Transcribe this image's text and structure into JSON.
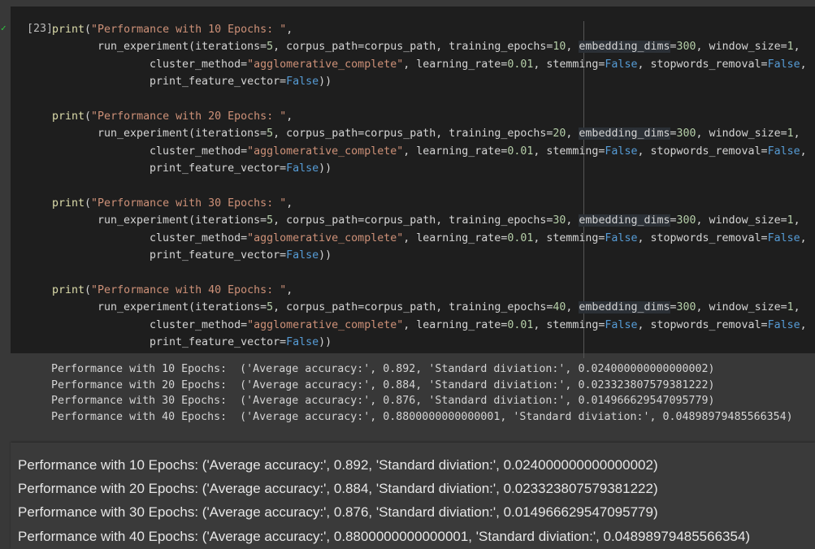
{
  "cell": {
    "execution_count": "[23]",
    "status_icon": "check-icon",
    "code_lines": [
      {
        "indent": 0,
        "tokens": [
          [
            "fn",
            "print"
          ],
          [
            "",
            "("
          ],
          [
            "str",
            "\"Performance with 10 Epochs: \""
          ],
          [
            "",
            ","
          ]
        ]
      },
      {
        "indent": 1,
        "tokens": [
          [
            "",
            "run_experiment(iterations="
          ],
          [
            "num",
            "5"
          ],
          [
            "",
            ", corpus_path=corpus_path, training_epochs="
          ],
          [
            "num",
            "10"
          ],
          [
            "",
            ", "
          ],
          [
            "hl",
            "embedding_dims"
          ],
          [
            "",
            "="
          ],
          [
            "num",
            "300"
          ],
          [
            "",
            ", window_size="
          ],
          [
            "num",
            "1"
          ],
          [
            "",
            ","
          ]
        ]
      },
      {
        "indent": 2,
        "tokens": [
          [
            "",
            "cluster_method="
          ],
          [
            "str",
            "\"agglomerative_complete\""
          ],
          [
            "",
            ", learning_rate="
          ],
          [
            "num",
            "0.01"
          ],
          [
            "",
            ", stemming="
          ],
          [
            "kw",
            "False"
          ],
          [
            "",
            ", stopwords_removal="
          ],
          [
            "kw",
            "False"
          ],
          [
            "",
            ","
          ]
        ]
      },
      {
        "indent": 2,
        "tokens": [
          [
            "",
            "print_feature_vector="
          ],
          [
            "kw",
            "False"
          ],
          [
            "",
            "))"
          ]
        ]
      },
      {
        "indent": 0,
        "tokens": [
          [
            "fn",
            "print"
          ],
          [
            "",
            "("
          ],
          [
            "str",
            "\"Performance with 20 Epochs: \""
          ],
          [
            "",
            ","
          ]
        ]
      },
      {
        "indent": 1,
        "tokens": [
          [
            "",
            "run_experiment(iterations="
          ],
          [
            "num",
            "5"
          ],
          [
            "",
            ", corpus_path=corpus_path, training_epochs="
          ],
          [
            "num",
            "20"
          ],
          [
            "",
            ", "
          ],
          [
            "hl",
            "embedding_dims"
          ],
          [
            "",
            "="
          ],
          [
            "num",
            "300"
          ],
          [
            "",
            ", window_size="
          ],
          [
            "num",
            "1"
          ],
          [
            "",
            ","
          ]
        ]
      },
      {
        "indent": 2,
        "tokens": [
          [
            "",
            "cluster_method="
          ],
          [
            "str",
            "\"agglomerative_complete\""
          ],
          [
            "",
            ", learning_rate="
          ],
          [
            "num",
            "0.01"
          ],
          [
            "",
            ", stemming="
          ],
          [
            "kw",
            "False"
          ],
          [
            "",
            ", stopwords_removal="
          ],
          [
            "kw",
            "False"
          ],
          [
            "",
            ","
          ]
        ]
      },
      {
        "indent": 2,
        "tokens": [
          [
            "",
            "print_feature_vector="
          ],
          [
            "kw",
            "False"
          ],
          [
            "",
            "))"
          ]
        ]
      },
      {
        "indent": 0,
        "tokens": [
          [
            "fn",
            "print"
          ],
          [
            "",
            "("
          ],
          [
            "str",
            "\"Performance with 30 Epochs: \""
          ],
          [
            "",
            ","
          ]
        ]
      },
      {
        "indent": 1,
        "tokens": [
          [
            "",
            "run_experiment(iterations="
          ],
          [
            "num",
            "5"
          ],
          [
            "",
            ", corpus_path=corpus_path, training_epochs="
          ],
          [
            "num",
            "30"
          ],
          [
            "",
            ", "
          ],
          [
            "hl",
            "embedding_dims"
          ],
          [
            "",
            "="
          ],
          [
            "num",
            "300"
          ],
          [
            "",
            ", window_size="
          ],
          [
            "num",
            "1"
          ],
          [
            "",
            ","
          ]
        ]
      },
      {
        "indent": 2,
        "tokens": [
          [
            "",
            "cluster_method="
          ],
          [
            "str",
            "\"agglomerative_complete\""
          ],
          [
            "",
            ", learning_rate="
          ],
          [
            "num",
            "0.01"
          ],
          [
            "",
            ", stemming="
          ],
          [
            "kw",
            "False"
          ],
          [
            "",
            ", stopwords_removal="
          ],
          [
            "kw",
            "False"
          ],
          [
            "",
            ","
          ]
        ]
      },
      {
        "indent": 2,
        "tokens": [
          [
            "",
            "print_feature_vector="
          ],
          [
            "kw",
            "False"
          ],
          [
            "",
            "))"
          ]
        ]
      },
      {
        "indent": 0,
        "tokens": [
          [
            "fn",
            "print"
          ],
          [
            "",
            "("
          ],
          [
            "str",
            "\"Performance with 40 Epochs: \""
          ],
          [
            "",
            ","
          ]
        ]
      },
      {
        "indent": 1,
        "tokens": [
          [
            "",
            "run_experiment(iterations="
          ],
          [
            "num",
            "5"
          ],
          [
            "",
            ", corpus_path=corpus_path, training_epochs="
          ],
          [
            "num",
            "40"
          ],
          [
            "",
            ", "
          ],
          [
            "hl",
            "embedding_dims"
          ],
          [
            "",
            "="
          ],
          [
            "num",
            "300"
          ],
          [
            "",
            ", window_size="
          ],
          [
            "num",
            "1"
          ],
          [
            "",
            ","
          ]
        ]
      },
      {
        "indent": 2,
        "tokens": [
          [
            "",
            "cluster_method="
          ],
          [
            "str",
            "\"agglomerative_complete\""
          ],
          [
            "",
            ", learning_rate="
          ],
          [
            "num",
            "0.01"
          ],
          [
            "",
            ", stemming="
          ],
          [
            "kw",
            "False"
          ],
          [
            "",
            ", stopwords_removal="
          ],
          [
            "kw",
            "False"
          ],
          [
            "",
            ","
          ]
        ]
      },
      {
        "indent": 2,
        "tokens": [
          [
            "",
            "print_feature_vector="
          ],
          [
            "kw",
            "False"
          ],
          [
            "",
            "))"
          ]
        ]
      }
    ]
  },
  "output": {
    "lines": [
      "Performance with 10 Epochs:  ('Average accuracy:', 0.892, 'Standard diviation:', 0.024000000000000002)",
      "Performance with 20 Epochs:  ('Average accuracy:', 0.884, 'Standard diviation:', 0.023323807579381222)",
      "Performance with 30 Epochs:  ('Average accuracy:', 0.876, 'Standard diviation:', 0.014966629547095779)",
      "Performance with 40 Epochs:  ('Average accuracy:', 0.8800000000000001, 'Standard diviation:', 0.04898979485566354)"
    ]
  },
  "rendered_output": {
    "lines": [
      "Performance with 10 Epochs: ('Average accuracy:', 0.892, 'Standard diviation:', 0.024000000000000002)",
      "Performance with 20 Epochs: ('Average accuracy:', 0.884, 'Standard diviation:', 0.023323807579381222)",
      "Performance with 30 Epochs: ('Average accuracy:', 0.876, 'Standard diviation:', 0.014966629547095779)",
      "Performance with 40 Epochs: ('Average accuracy:', 0.8800000000000001, 'Standard diviation:', 0.04898979485566354)"
    ]
  }
}
